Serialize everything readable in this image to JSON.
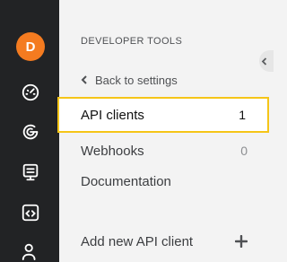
{
  "user": {
    "avatar_initial": "D",
    "avatar_color": "#f47b20"
  },
  "rail": {
    "icons": [
      "dashboard-gauge-icon",
      "analytics-swirl-icon",
      "monitor-list-icon",
      "code-window-icon",
      "users-icon"
    ]
  },
  "panel": {
    "section_title": "DEVELOPER TOOLS",
    "back_label": "Back to settings",
    "items": [
      {
        "label": "API clients",
        "count": "1",
        "active": true
      },
      {
        "label": "Webhooks",
        "count": "0",
        "active": false
      },
      {
        "label": "Documentation",
        "count": "",
        "active": false
      }
    ],
    "add_label": "Add new API client"
  },
  "colors": {
    "accent": "#f5c518",
    "rail_bg": "#222325",
    "panel_bg": "#f3f3f3"
  }
}
